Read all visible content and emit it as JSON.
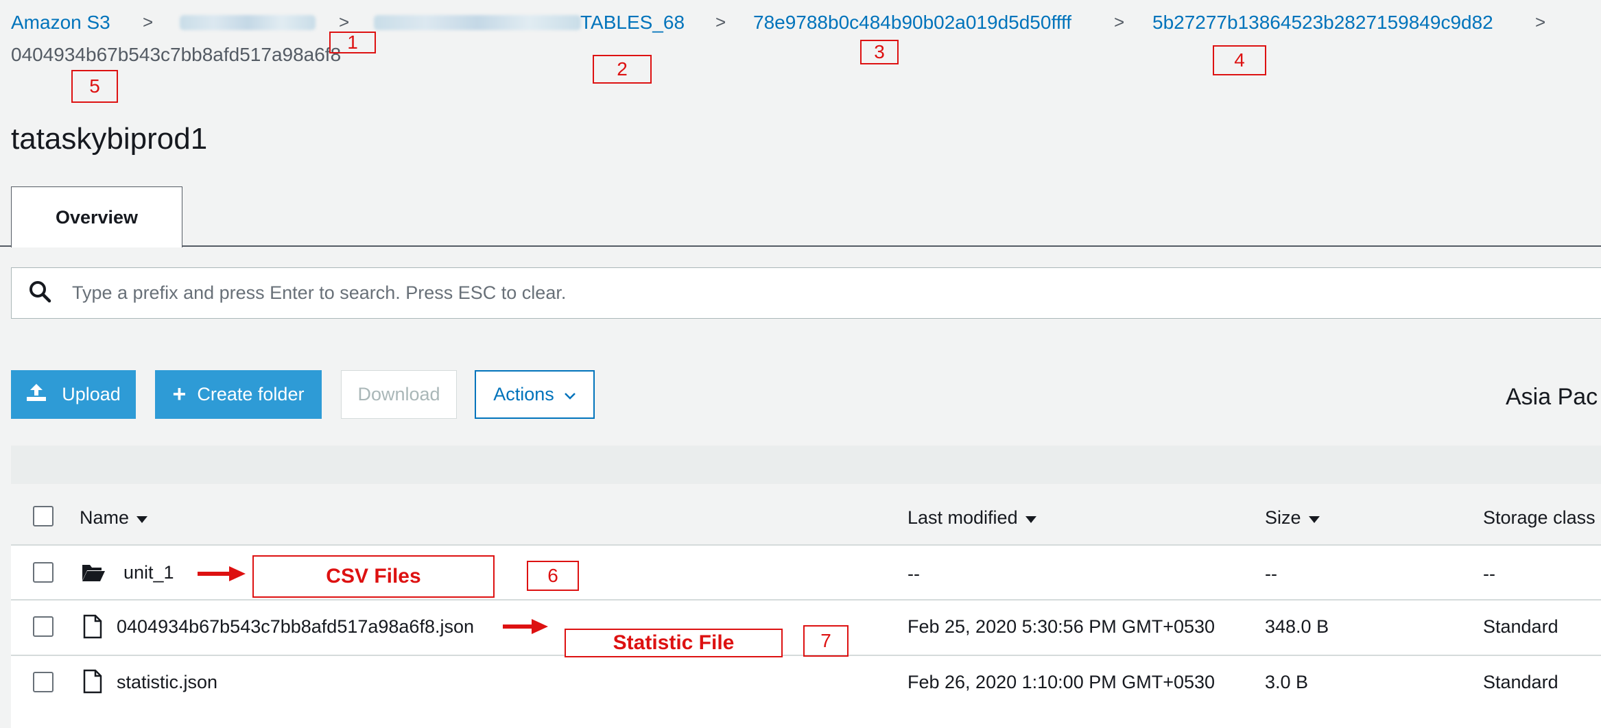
{
  "breadcrumb": {
    "root": "Amazon S3",
    "partial_tables": "TABLES_68",
    "folder_a": "78e9788b0c484b90b02a019d5d50ffff",
    "folder_b": "5b27277b13864523b2827159849c9d82",
    "current": "0404934b67b543c7bb8afd517a98a6f8",
    "separator": ">"
  },
  "annotations": {
    "n1": "1",
    "n2": "2",
    "n3": "3",
    "n4": "4",
    "n5": "5",
    "n6": "6",
    "n7": "7",
    "csv_label": "CSV Files",
    "statistic_label": "Statistic File",
    "color": "#dd1111"
  },
  "page": {
    "title": "tataskybiprod1",
    "tab_overview": "Overview",
    "region_partial": "Asia Pac"
  },
  "search": {
    "placeholder": "Type a prefix and press Enter to search. Press ESC to clear."
  },
  "toolbar": {
    "upload": "Upload",
    "create_folder": "Create folder",
    "download": "Download",
    "actions": "Actions"
  },
  "table": {
    "headers": {
      "name": "Name",
      "last_modified": "Last modified",
      "size": "Size",
      "storage_class": "Storage class"
    },
    "rows": [
      {
        "name": "unit_1",
        "last_modified": "--",
        "size": "--",
        "storage_class": "--",
        "type": "folder-icon"
      },
      {
        "name": "0404934b67b543c7bb8afd517a98a6f8.json",
        "last_modified": "Feb 25, 2020 5:30:56 PM GMT+0530",
        "size": "348.0 B",
        "storage_class": "Standard",
        "type": "file-icon"
      },
      {
        "name": "statistic.json",
        "last_modified": "Feb 26, 2020 1:10:00 PM GMT+0530",
        "size": "3.0 B",
        "storage_class": "Standard",
        "type": "file-icon"
      }
    ]
  },
  "colors": {
    "link": "#0073bb",
    "primary_button": "#2e9bd6",
    "background": "#f2f3f3"
  }
}
